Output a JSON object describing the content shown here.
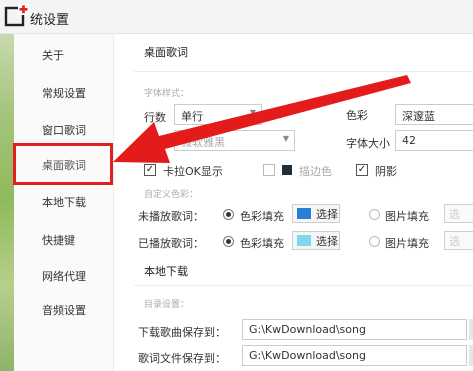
{
  "window": {
    "title": "统设置"
  },
  "sidebar": {
    "items": [
      {
        "label": "关于"
      },
      {
        "label": "常规设置"
      },
      {
        "label": "窗口歌词"
      },
      {
        "label": "桌面歌词"
      },
      {
        "label": "本地下载"
      },
      {
        "label": "快捷键"
      },
      {
        "label": "网络代理"
      },
      {
        "label": "音频设置"
      }
    ],
    "selected": "桌面歌词"
  },
  "desktop_lyrics": {
    "title": "桌面歌词",
    "font_style_label": "字体样式：",
    "lines_label": "行数",
    "lines_value": "单行",
    "color_label": "色彩",
    "color_value": "深邃蓝",
    "font_label_partial": "字",
    "font_value_partial": "微软雅黑",
    "font_size_label": "字体大小",
    "font_size_value": "42",
    "karaoke_label": "卡拉OK显示",
    "karaoke_checked": true,
    "outline_label": "描边色",
    "outline_checked": false,
    "outline_color": "#222d3a",
    "shadow_label": "阴影",
    "shadow_checked": true,
    "custom_color_label": "自定义色彩：",
    "unplayed_label": "未播放歌词：",
    "played_label": "已播放歌词：",
    "color_fill_label": "色彩填充",
    "image_fill_label": "图片填充",
    "choose_label": "选择",
    "choose_partial": "选",
    "unplayed_swatch": "#2a7fd4",
    "played_swatch": "#7fd7ea"
  },
  "local_download": {
    "title": "本地下载",
    "dir_label": "目录设置：",
    "song_path_label": "下载歌曲保存到：",
    "song_path_value": "G:\\KwDownload\\song",
    "lyric_path_label": "歌词文件保存到：",
    "lyric_path_value": "G:\\KwDownload\\song"
  },
  "annotation": {
    "arrow_color": "#e41b1b",
    "box_color": "#e02020"
  }
}
